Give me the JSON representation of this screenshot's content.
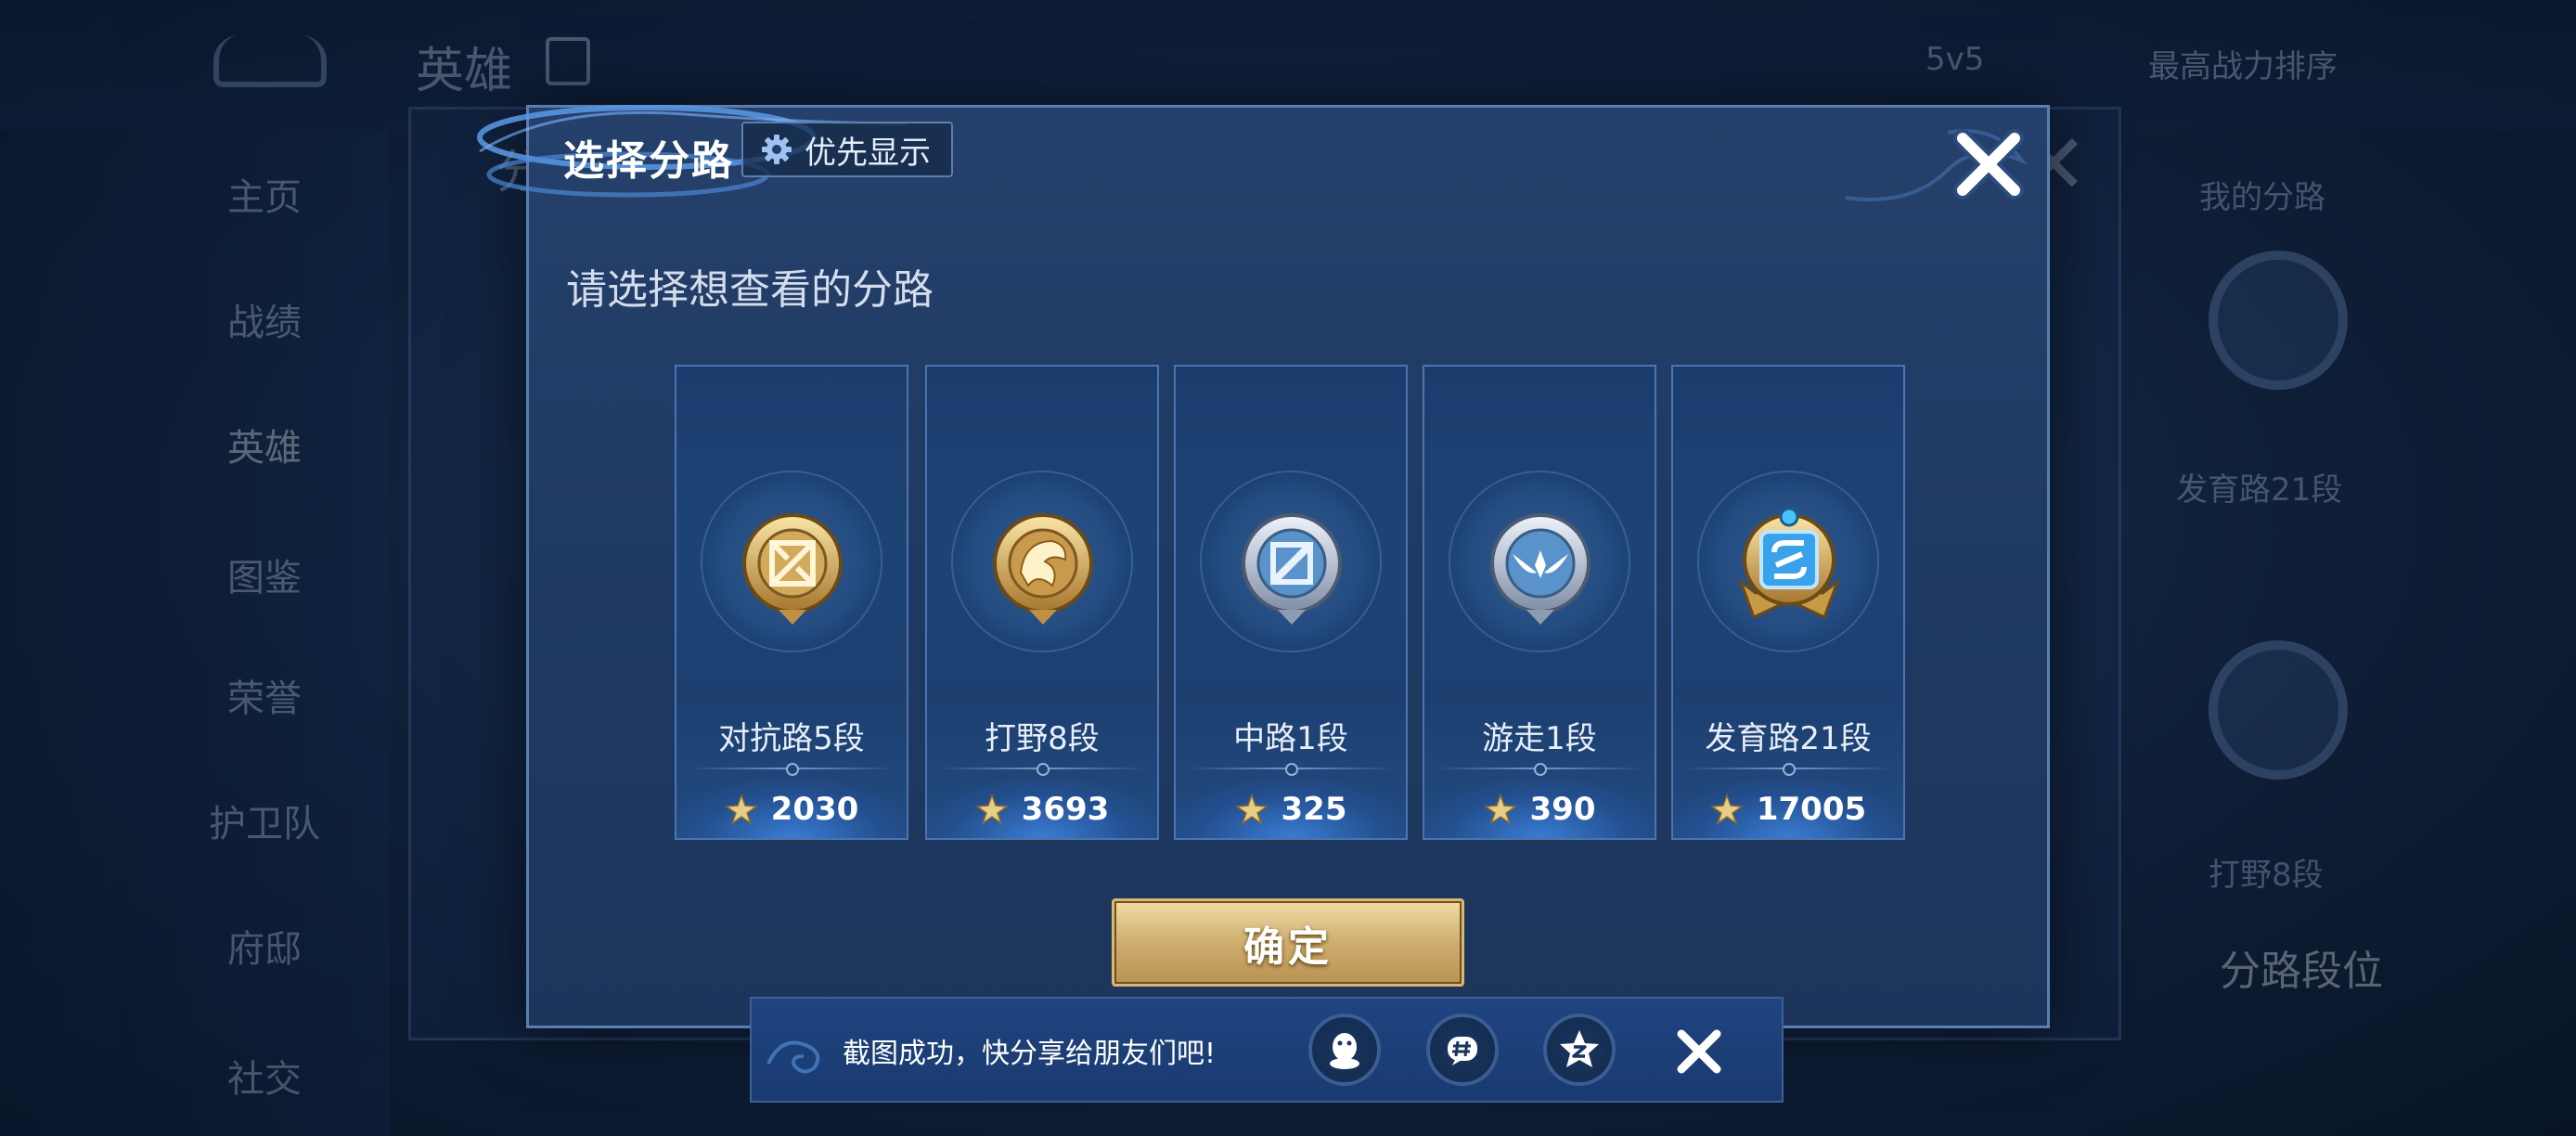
{
  "background": {
    "page_title": "英雄",
    "top_right": [
      "5v5",
      "最高战力排序"
    ],
    "nav_items": [
      {
        "label": "主页"
      },
      {
        "label": "战绩"
      },
      {
        "label": "英雄"
      },
      {
        "label": "图鉴"
      },
      {
        "label": "荣誉"
      },
      {
        "label": "护卫队"
      },
      {
        "label": "府邸"
      },
      {
        "label": "社交"
      }
    ],
    "frame_title": "分",
    "right_panel": {
      "items": [
        "我的分路",
        "发育路21段",
        "打野8段",
        "分路段位"
      ]
    }
  },
  "dialog": {
    "title": "选择分路",
    "priority_button": "优先显示",
    "subtitle": "请选择想查看的分路",
    "confirm_button": "确定",
    "lanes": [
      {
        "name": "对抗路5段",
        "score": "2030",
        "badge": "clash-lane-badge-icon",
        "tier": "gold"
      },
      {
        "name": "打野8段",
        "score": "3693",
        "badge": "jungle-dragon-badge-icon",
        "tier": "gold"
      },
      {
        "name": "中路1段",
        "score": "325",
        "badge": "mid-lane-badge-icon",
        "tier": "silver"
      },
      {
        "name": "游走1段",
        "score": "390",
        "badge": "roam-wings-badge-icon",
        "tier": "silver"
      },
      {
        "name": "发育路21段",
        "score": "17005",
        "badge": "farm-lane-badge-icon",
        "tier": "diamond"
      }
    ]
  },
  "toast": {
    "message": "截图成功，快分享给朋友们吧!",
    "share_targets": [
      "qq-icon",
      "wechat-moments-icon",
      "qzone-icon"
    ]
  },
  "colors": {
    "panel": "#1f3a63",
    "card": "#1d4375",
    "gold": "#d9b770",
    "accent_blue": "#4b74b2"
  }
}
